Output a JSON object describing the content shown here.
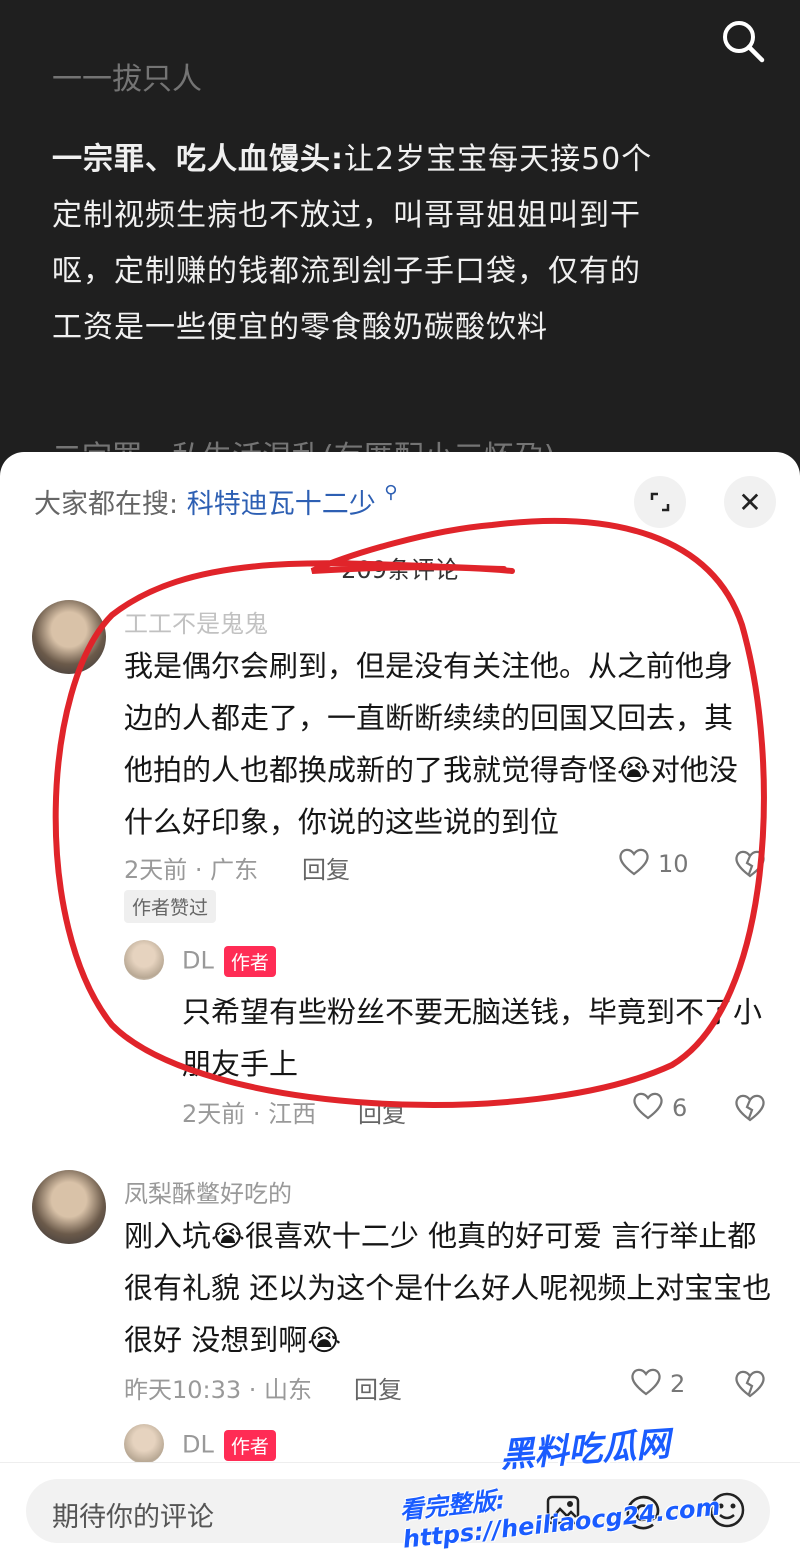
{
  "post": {
    "cut_top": "一一拔只人",
    "title_bold": "一宗罪、吃人血馒头:",
    "body": "让2岁宝宝每天接50个定制视频生病也不放过，叫哥哥姐姐叫到干呕，定制赚的钱都流到刽子手口袋，仅有的工资是一些便宜的零食酸奶碳酸饮料",
    "cut_bottom": "二宗罪、私生活混乱(有匿配小三怀孕)"
  },
  "sheet": {
    "search_prefix": "大家都在搜:",
    "search_hot": "科特迪瓦十二少",
    "comment_count": "209条评论"
  },
  "comments": [
    {
      "user": "工工不是鬼鬼",
      "text": "我是偶尔会刷到，但是没有关注他。从之前他身边的人都走了，一直断断续续的回国又回去，其他拍的人也都换成新的了我就觉得奇怪😭对他没什么好印象，你说的这些说的到位",
      "time": "2天前 · 广东",
      "reply": "回复",
      "likes": "10",
      "badge": "作者赞过"
    },
    {
      "user": "DL",
      "author_tag": "作者",
      "text": "只希望有些粉丝不要无脑送钱，毕竟到不了小朋友手上",
      "time": "2天前 · 江西",
      "reply": "回复",
      "likes": "6"
    },
    {
      "user": "凤梨酥鳖好吃的",
      "text": "刚入坑😭很喜欢十二少 他真的好可爱 言行举止都很有礼貌 还以为这个是什么好人呢视频上对宝宝也很好 没想到啊😭",
      "time": "昨天10:33 · 山东",
      "reply": "回复",
      "likes": "2"
    },
    {
      "user": "DL",
      "author_tag": "作者"
    }
  ],
  "bottom_bar": {
    "placeholder": "期待你的评论"
  },
  "watermark": {
    "brand": "黑料吃瓜网",
    "url_label": "看完整版: https://heiliaocg24.com"
  },
  "colors": {
    "accent_red": "#ff2c55",
    "link_blue": "#2d5fb3",
    "annotation_red": "#e0242a"
  }
}
